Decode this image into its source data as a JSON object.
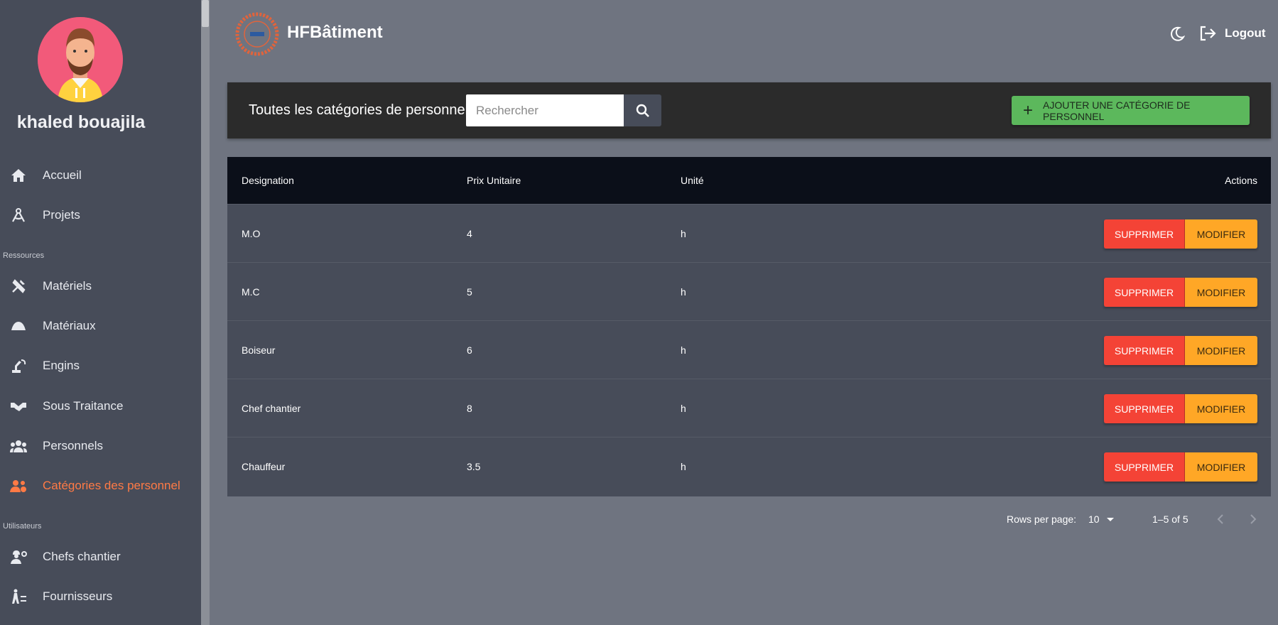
{
  "sidebar": {
    "user_name": "khaled bouajila",
    "items": [
      {
        "label": "Accueil",
        "icon": "home-icon"
      },
      {
        "label": "Projets",
        "icon": "compass-icon"
      },
      {
        "label": "Matériels",
        "icon": "tools-icon"
      },
      {
        "label": "Matériaux",
        "icon": "pile-icon"
      },
      {
        "label": "Engins",
        "icon": "excavator-icon"
      },
      {
        "label": "Sous Traitance",
        "icon": "handshake-icon"
      },
      {
        "label": "Personnels",
        "icon": "people-icon"
      },
      {
        "label": "Catégories des personnel",
        "icon": "people-group-icon"
      },
      {
        "label": "Chefs chantier",
        "icon": "worker-icon"
      },
      {
        "label": "Fournisseurs",
        "icon": "supplier-icon"
      }
    ],
    "sections": {
      "resources": "Ressources",
      "users": "Utilisateurs"
    },
    "active_color": "#ff7a45"
  },
  "header": {
    "brand": "HFBâtiment",
    "logout_label": "Logout"
  },
  "toolbar": {
    "title": "Toutes les catégories de personnel",
    "search_placeholder": "Rechercher",
    "search_value": "",
    "add_label": "AJOUTER UNE CATÉGORIE DE PERSONNEL"
  },
  "table": {
    "headers": {
      "designation": "Designation",
      "prix": "Prix Unitaire",
      "unite": "Unité",
      "actions": "Actions"
    },
    "rows": [
      {
        "designation": "M.O",
        "prix": "4",
        "unite": "h"
      },
      {
        "designation": "M.C",
        "prix": "5",
        "unite": "h"
      },
      {
        "designation": "Boiseur",
        "prix": "6",
        "unite": "h"
      },
      {
        "designation": "Chef chantier",
        "prix": "8",
        "unite": "h"
      },
      {
        "designation": "Chauffeur",
        "prix": "3.5",
        "unite": "h"
      }
    ],
    "delete_label": "SUPPRIMER",
    "edit_label": "MODIFIER"
  },
  "pagination": {
    "rows_per_page_label": "Rows per page:",
    "rows_per_page": "10",
    "range": "1–5 of 5"
  },
  "colors": {
    "sidebar_bg": "#474c59",
    "page_bg": "#6f7480",
    "toolbar_bg": "#2b2b2b",
    "table_header_bg": "#0b0f19",
    "add_button": "#5cb85c",
    "delete_button": "#f44336",
    "edit_button": "#ffa726"
  }
}
